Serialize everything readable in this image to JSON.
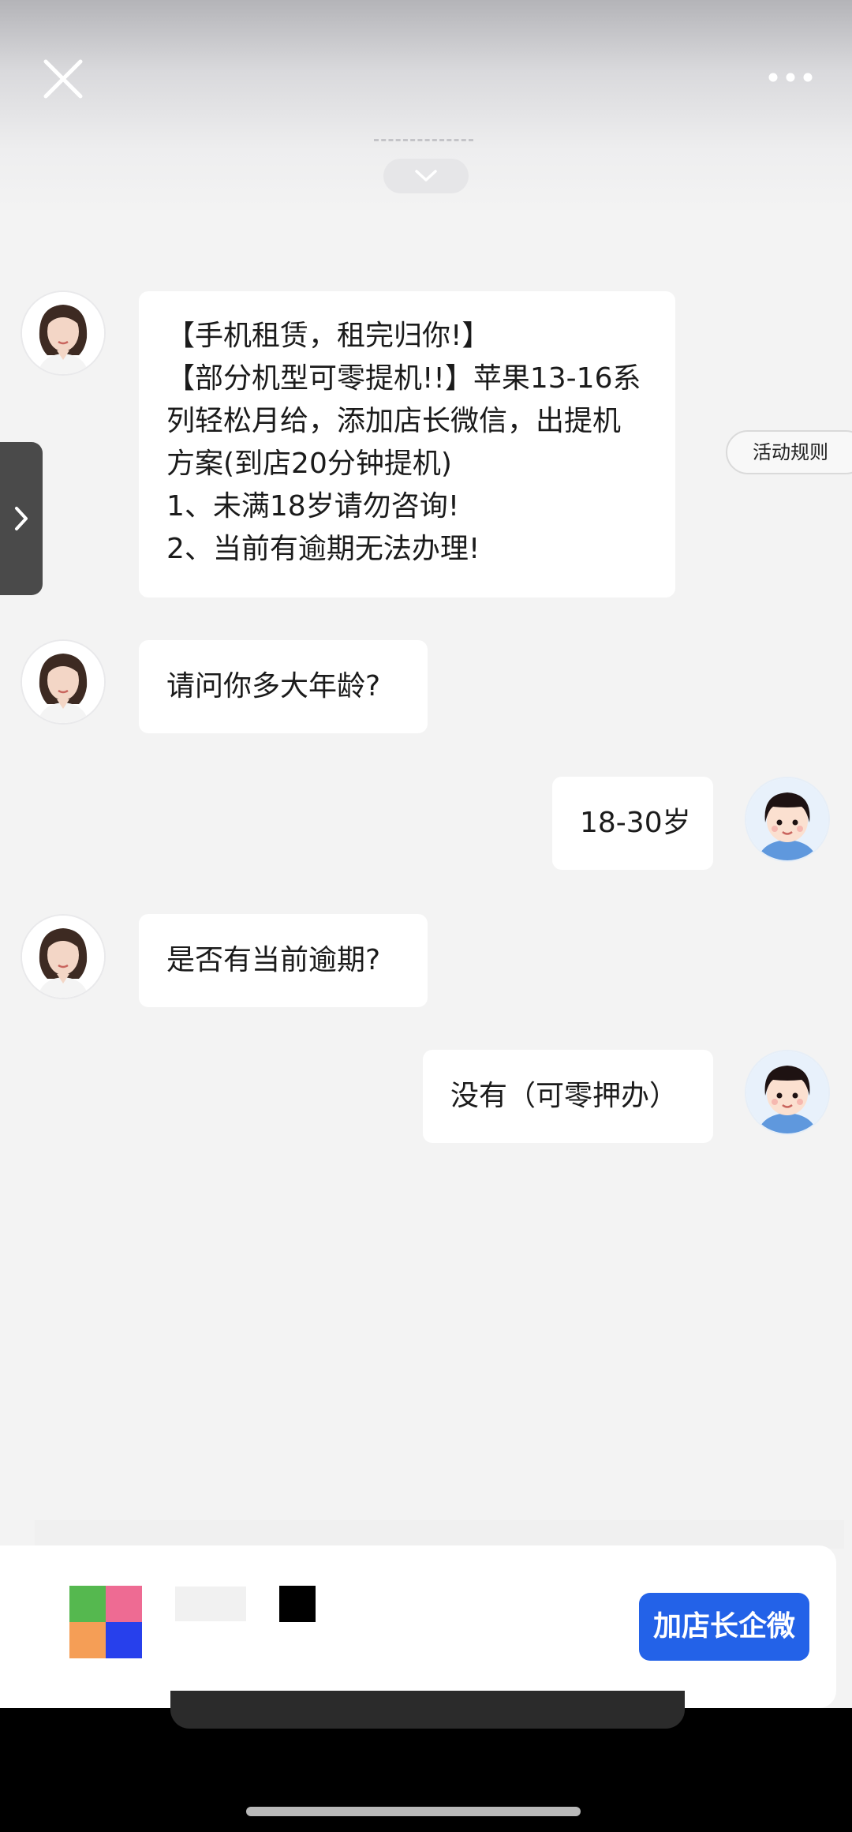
{
  "header": {
    "close_icon": "close-icon",
    "more_icon": "more-horizontal-icon",
    "collapse_icon": "chevron-down-icon"
  },
  "messages": [
    {
      "from": "agent",
      "lines": [
        "【手机租赁，租完归你!】",
        "【部分机型可零提机!!】苹果13-16系",
        "列轻松月给，添加店长微信，出提机",
        "方案(到店20分钟提机)",
        "1、未满18岁请勿咨询!",
        "2、当前有逾期无法办理!"
      ]
    },
    {
      "from": "agent",
      "text": "请问你多大年龄?"
    },
    {
      "from": "user",
      "text": "18-30岁"
    },
    {
      "from": "agent",
      "text": "是否有当前逾期?"
    },
    {
      "from": "user",
      "text": "没有（可零押办）"
    }
  ],
  "side_tab": {
    "icon": "chevron-right-icon"
  },
  "rules_button": {
    "label": "活动规则"
  },
  "footer": {
    "logo_colors": [
      "#55b84f",
      "#ee6b93",
      "#f59e56",
      "#2740ec"
    ],
    "add_button_label": "加店长企微",
    "accent": "#2362e8"
  }
}
